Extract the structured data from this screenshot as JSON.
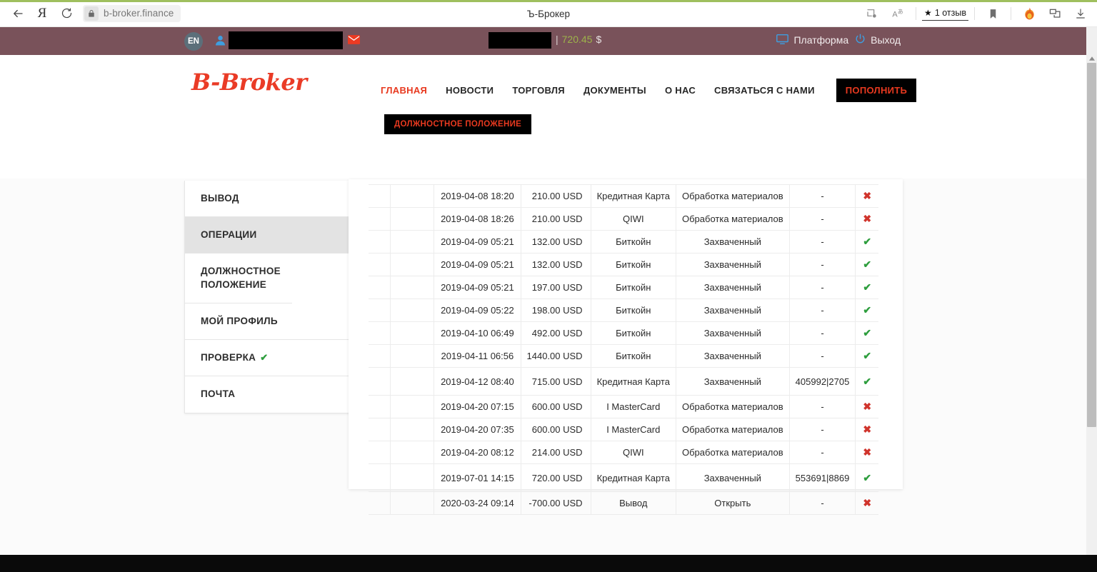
{
  "browser": {
    "back_icon": "back-arrow-icon",
    "yandex_icon": "yandex-logo-icon",
    "reload_icon": "reload-icon",
    "lock_icon": "lock-icon",
    "url": "b-broker.finance",
    "tab_title": "Ъ-Брокер",
    "right_icons": {
      "cast_icon": "cast-icon",
      "translate_icon": "translate-icon",
      "bookmark_icon": "bookmark-icon",
      "fire_icon": "fire-icon",
      "collections_icon": "collections-icon",
      "download_icon": "download-icon"
    },
    "review_chip": {
      "star": "★",
      "label": "1 отзыв"
    }
  },
  "topbar": {
    "lang": "EN",
    "user_icon": "user-icon",
    "mail_icon": "mail-icon",
    "balance": {
      "separator": "|",
      "amount": "720.45",
      "currency": "$"
    },
    "platform_label": "Платформа",
    "platform_icon": "monitor-icon",
    "logout_label": "Выход",
    "logout_icon": "power-icon",
    "bg_color": "#79525a"
  },
  "header": {
    "logo": "B-Broker",
    "logo_color": "#ea3b26",
    "nav": [
      {
        "label": "ГЛАВНАЯ",
        "active": true
      },
      {
        "label": "НОВОСТИ",
        "active": false
      },
      {
        "label": "ТОРГОВЛЯ",
        "active": false
      },
      {
        "label": "ДОКУМЕНТЫ",
        "active": false
      },
      {
        "label": "О НАС",
        "active": false
      },
      {
        "label": "СВЯЗАТЬСЯ С НАМИ",
        "active": false
      }
    ],
    "deposit_button": "ПОПОЛНИТЬ",
    "regulation_button": "ДОЛЖНОСТНОЕ ПОЛОЖЕНИЕ",
    "accent_color": "#e8391f"
  },
  "sidebar": {
    "items": [
      {
        "label": "ВЫВОД",
        "active": false,
        "check": ""
      },
      {
        "label": "ОПЕРАЦИИ",
        "active": true,
        "check": ""
      },
      {
        "label": "ДОЛЖНОСТНОЕ ПОЛОЖЕНИЕ",
        "active": false,
        "check": ""
      },
      {
        "label": "МОЙ ПРОФИЛЬ",
        "active": false,
        "check": ""
      },
      {
        "label": "ПРОВЕРКА",
        "active": false,
        "check": "✔"
      },
      {
        "label": "ПОЧТА",
        "active": false,
        "check": ""
      }
    ]
  },
  "operations_table": {
    "status_ok_icon": "✔",
    "status_bad_icon": "✖",
    "ok_color": "#2e9e3e",
    "bad_color": "#d0342c",
    "rows": [
      {
        "date": "2019-04-08 18:20",
        "amount": "210.00 USD",
        "method": "Кредитная Карта",
        "status": "Обработка материалов",
        "ref": "-",
        "flag": "bad",
        "tall": false
      },
      {
        "date": "2019-04-08 18:26",
        "amount": "210.00 USD",
        "method": "QIWI",
        "status": "Обработка материалов",
        "ref": "-",
        "flag": "bad",
        "tall": false
      },
      {
        "date": "2019-04-09 05:21",
        "amount": "132.00 USD",
        "method": "Биткойн",
        "status": "Захваченный",
        "ref": "-",
        "flag": "ok",
        "tall": false
      },
      {
        "date": "2019-04-09 05:21",
        "amount": "132.00 USD",
        "method": "Биткойн",
        "status": "Захваченный",
        "ref": "-",
        "flag": "ok",
        "tall": false
      },
      {
        "date": "2019-04-09 05:21",
        "amount": "197.00 USD",
        "method": "Биткойн",
        "status": "Захваченный",
        "ref": "-",
        "flag": "ok",
        "tall": false
      },
      {
        "date": "2019-04-09 05:22",
        "amount": "198.00 USD",
        "method": "Биткойн",
        "status": "Захваченный",
        "ref": "-",
        "flag": "ok",
        "tall": false
      },
      {
        "date": "2019-04-10 06:49",
        "amount": "492.00 USD",
        "method": "Биткойн",
        "status": "Захваченный",
        "ref": "-",
        "flag": "ok",
        "tall": false
      },
      {
        "date": "2019-04-11 06:56",
        "amount": "1440.00 USD",
        "method": "Биткойн",
        "status": "Захваченный",
        "ref": "-",
        "flag": "ok",
        "tall": false
      },
      {
        "date": "2019-04-12 08:40",
        "amount": "715.00 USD",
        "method": "Кредитная Карта",
        "status": "Захваченный",
        "ref": "405992|2705",
        "flag": "ok",
        "tall": true
      },
      {
        "date": "2019-04-20 07:15",
        "amount": "600.00 USD",
        "method": "I MasterCard",
        "status": "Обработка материалов",
        "ref": "-",
        "flag": "bad",
        "tall": false
      },
      {
        "date": "2019-04-20 07:35",
        "amount": "600.00 USD",
        "method": "I MasterCard",
        "status": "Обработка материалов",
        "ref": "-",
        "flag": "bad",
        "tall": false
      },
      {
        "date": "2019-04-20 08:12",
        "amount": "214.00 USD",
        "method": "QIWI",
        "status": "Обработка материалов",
        "ref": "-",
        "flag": "bad",
        "tall": false
      },
      {
        "date": "2019-07-01 14:15",
        "amount": "720.00 USD",
        "method": "Кредитная Карта",
        "status": "Захваченный",
        "ref": "553691|8869",
        "flag": "ok",
        "tall": true
      },
      {
        "date": "2020-03-24 09:14",
        "amount": "-700.00 USD",
        "method": "Вывод",
        "status": "Открыть",
        "ref": "-",
        "flag": "bad",
        "tall": false
      }
    ]
  }
}
